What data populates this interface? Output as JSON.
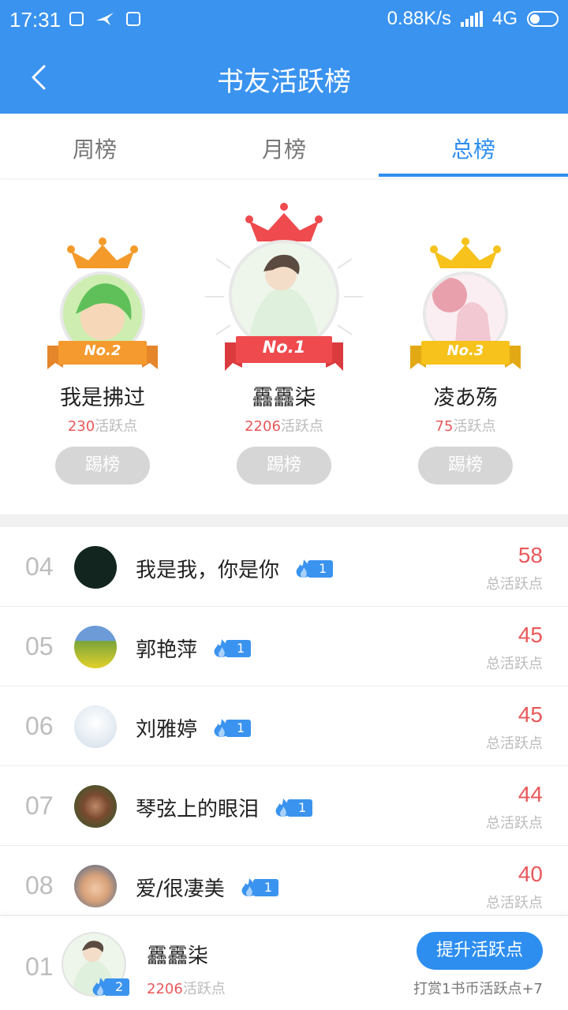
{
  "status_bar": {
    "time": "17:31",
    "speed": "0.88K/s",
    "network": "4G"
  },
  "header": {
    "title": "书友活跃榜"
  },
  "tabs": [
    {
      "label": "周榜",
      "active": false
    },
    {
      "label": "月榜",
      "active": false
    },
    {
      "label": "总榜",
      "active": true
    }
  ],
  "podium": {
    "first": {
      "rank_label": "No.1",
      "name": "靐靐柒",
      "points": "2206",
      "points_suffix": "活跃点",
      "kick_label": "踢榜"
    },
    "second": {
      "rank_label": "No.2",
      "name": "我是拂过",
      "points": "230",
      "points_suffix": "活跃点",
      "kick_label": "踢榜"
    },
    "third": {
      "rank_label": "No.3",
      "name": "凌あ殇",
      "points": "75",
      "points_suffix": "活跃点",
      "kick_label": "踢榜"
    }
  },
  "list": [
    {
      "rank": "04",
      "name": "我是我，你是你",
      "level": "1",
      "score": "58",
      "score_label": "总活跃点"
    },
    {
      "rank": "05",
      "name": "郭艳萍",
      "level": "1",
      "score": "45",
      "score_label": "总活跃点"
    },
    {
      "rank": "06",
      "name": "刘雅婷",
      "level": "1",
      "score": "45",
      "score_label": "总活跃点"
    },
    {
      "rank": "07",
      "name": "琴弦上的眼泪",
      "level": "1",
      "score": "44",
      "score_label": "总活跃点"
    },
    {
      "rank": "08",
      "name": "爱/很凄美",
      "level": "1",
      "score": "40",
      "score_label": "总活跃点"
    }
  ],
  "me": {
    "rank": "01",
    "name": "靐靐柒",
    "level": "2",
    "points": "2206",
    "points_suffix": "活跃点",
    "boost_label": "提升活跃点",
    "hint": "打赏1书币活跃点+7"
  },
  "colors": {
    "primary": "#3a93ef",
    "score_red": "#e8585a",
    "gold_crown": "#f6c21b",
    "silver_crown": "#f49a2b",
    "first_crown": "#ef4a4e"
  }
}
